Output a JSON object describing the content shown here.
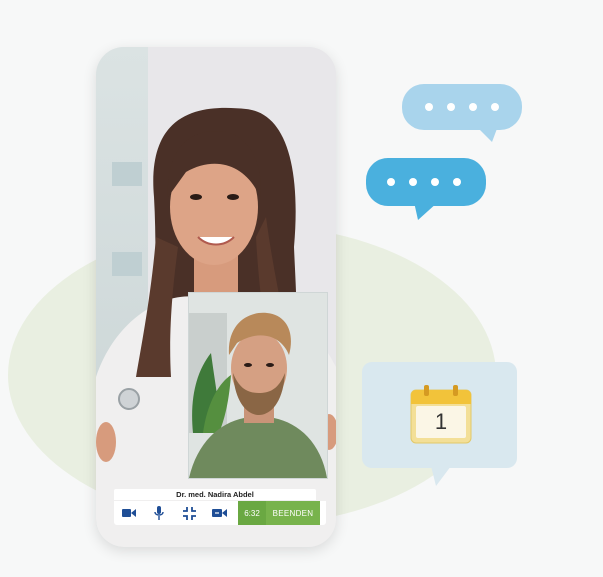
{
  "call": {
    "caller_name": "Dr. med. Nadira Abdel",
    "timer": "6:32",
    "end_label": "BEENDEN"
  },
  "calendar": {
    "day": "1"
  },
  "icons": [
    "video-camera-icon",
    "microphone-icon",
    "collapse-icon",
    "switch-camera-icon",
    "calendar-icon",
    "chat-bubble-icon"
  ],
  "colors": {
    "accent_green": "#78b34c",
    "accent_blue": "#1f4e96",
    "bubble_light": "#a9d4ec",
    "bubble_dark": "#4ab0de"
  }
}
